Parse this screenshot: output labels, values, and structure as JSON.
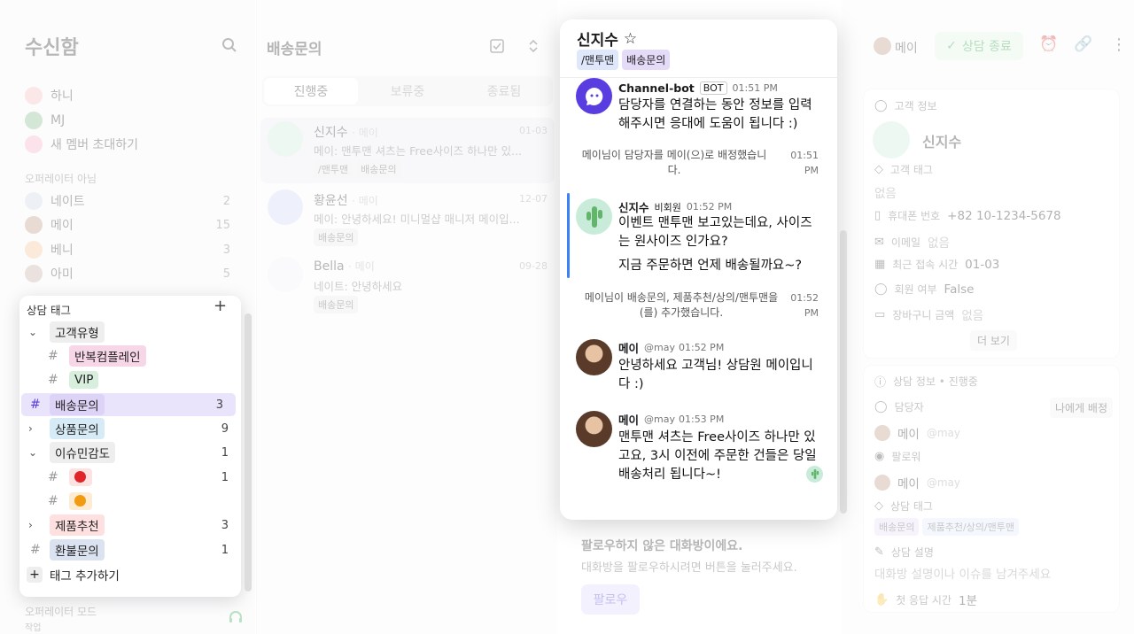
{
  "left": {
    "title": "수신함",
    "members": [
      {
        "name": "하니"
      },
      {
        "name": "MJ"
      },
      {
        "name": "새 멤버 초대하기"
      }
    ],
    "offline_title": "오퍼레이터 아님",
    "offline": [
      {
        "name": "네이트",
        "count": "2"
      },
      {
        "name": "메이",
        "count": "15"
      },
      {
        "name": "베니",
        "count": "3"
      },
      {
        "name": "아미",
        "count": "5"
      }
    ],
    "mode_label": "오퍼레이터 모드",
    "bottom_text": "작업"
  },
  "tag_menu": {
    "title": "상담 태그",
    "items": [
      {
        "label": "고객유형",
        "count": "",
        "color": "#eeeeee"
      },
      {
        "label": "반복컴플레인",
        "count": "",
        "color": "#f7d6e8"
      },
      {
        "label": "VIP",
        "count": "",
        "color": "#d7efdc"
      },
      {
        "label": "배송문의",
        "count": "3",
        "color": "#ddd3f6"
      },
      {
        "label": "상품문의",
        "count": "9",
        "color": "#d7ebf7"
      },
      {
        "label": "이슈민감도",
        "count": "1",
        "color": "#eeeeee"
      },
      {
        "label": "",
        "count": "1",
        "color": "#fde2e2"
      },
      {
        "label": "",
        "count": "",
        "color": "#fdebd3"
      },
      {
        "label": "제품추천",
        "count": "3",
        "color": "#fde0df"
      },
      {
        "label": "환불문의",
        "count": "1",
        "color": "#dbe2f0"
      }
    ],
    "add_label": "태그 추가하기"
  },
  "middle": {
    "title": "배송문의",
    "tabs": [
      "진행중",
      "보류중",
      "종료됨"
    ],
    "chats": [
      {
        "name": "신지수",
        "assignee": "· 메이",
        "time": "01-03",
        "preview": "메이: 맨투맨 셔츠는 Free사이즈 하나만 있...",
        "tags": [
          "/맨투맨",
          "배송문의"
        ]
      },
      {
        "name": "황윤선",
        "assignee": "· 메이",
        "time": "12-07",
        "preview": "메이: 안녕하세요! 미니멀샵 매니저 메이입...",
        "tags": [
          "배송문의"
        ]
      },
      {
        "name": "Bella",
        "assignee": "· 메이",
        "time": "09-28",
        "preview": "네이트: 안녕하세요",
        "tags": [
          "배송문의"
        ]
      }
    ],
    "follow_title": "팔로우하지 않은 대화방이에요.",
    "follow_desc": "대화방을 팔로우하시려면 버튼을 눌러주세요.",
    "follow_button": "팔로우"
  },
  "popup": {
    "name": "신지수",
    "tags": [
      {
        "label": "/맨투맨",
        "color": "#dfe7fb"
      },
      {
        "label": "배송문의",
        "color": "#e4dbf8"
      }
    ],
    "messages": [
      {
        "sender": "Channel-bot",
        "badge": "BOT",
        "time": "01:51 PM",
        "text": "담당자를 연결하는 동안 정보를 입력해주시면 응대에 도움이 됩니다 :)"
      },
      {
        "system": "메이님이 담당자를 메이(으)로 배정했습니다.",
        "time": "01:51 PM"
      },
      {
        "sender": "신지수",
        "badge": "비회원",
        "time": "01:52 PM",
        "text": "이벤트 맨투맨 보고있는데요, 사이즈는 원사이즈 인가요?",
        "text2": "지금 주문하면 언제 배송될까요~?"
      },
      {
        "system": "메이님이 배송문의, 제품추천/상의/맨투맨을(를) 추가했습니다.",
        "time": "01:52 PM"
      },
      {
        "sender": "메이",
        "handle": "@may",
        "time": "01:52 PM",
        "text": "안녕하세요 고객님! 상담원 메이입니다 :)"
      },
      {
        "sender": "메이",
        "handle": "@may",
        "time": "01:53 PM",
        "text": "맨투맨 셔츠는 Free사이즈 하나만 있고요, 3시 이전에 주문한 건들은 당일 배송처리 됩니다~!"
      }
    ]
  },
  "header_right": {
    "agent": "메이",
    "close_button": "상담 종료"
  },
  "customer": {
    "section_title": "고객 정보",
    "name": "신지수",
    "tag_label": "고객 태그",
    "tag_value": "없음",
    "phone_label": "휴대폰 번호",
    "phone": "+82 10-1234-5678",
    "email_label": "이메일",
    "email": "없음",
    "last_label": "최근 접속 시간",
    "last": "01-03",
    "member_label": "회원 여부",
    "member": "False",
    "cart_label": "장바구니 금액",
    "cart": "없음",
    "more": "더 보기"
  },
  "consult": {
    "section_title": "상담 정보 • 진행중",
    "assignee_label": "담당자",
    "assign_me": "나에게 배정",
    "assignee": "메이",
    "assignee_handle": "@may",
    "follower_label": "팔로워",
    "follower": "메이",
    "follower_handle": "@may",
    "tags_label": "상담 태그",
    "tags": [
      "배송문의",
      "제품추천/상의/맨투맨"
    ],
    "desc_label": "상담 설명",
    "desc_placeholder": "대화방 설명이나 이슈를 남겨주세요",
    "first_label": "첫 응답 시간",
    "first_value": "1분"
  },
  "colors": {
    "accent": "#3b82f6",
    "cactus": "#62b56a",
    "bot": "#5a3de0",
    "green": "#2aa745"
  }
}
